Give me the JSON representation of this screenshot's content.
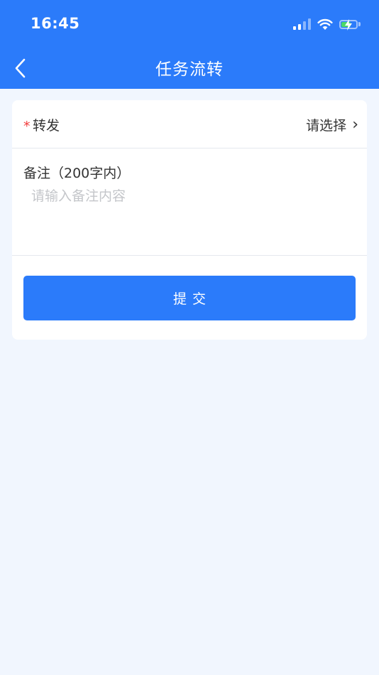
{
  "status_bar": {
    "time": "16:45",
    "icons": [
      "signal-icon",
      "wifi-icon",
      "battery-charging-icon"
    ]
  },
  "nav": {
    "back_icon": "chevron-left-icon",
    "title": "任务流转"
  },
  "form": {
    "forward": {
      "required_mark": "*",
      "label": "转发",
      "value_placeholder": "请选择",
      "arrow": "›"
    },
    "note": {
      "label": "备注（200字内）",
      "placeholder": "请输入备注内容",
      "value": ""
    },
    "submit_label": "提交"
  },
  "colors": {
    "primary": "#2b7bfa",
    "background": "#f1f6fe",
    "required": "#f23c3c",
    "placeholder": "#c4c6ca"
  }
}
